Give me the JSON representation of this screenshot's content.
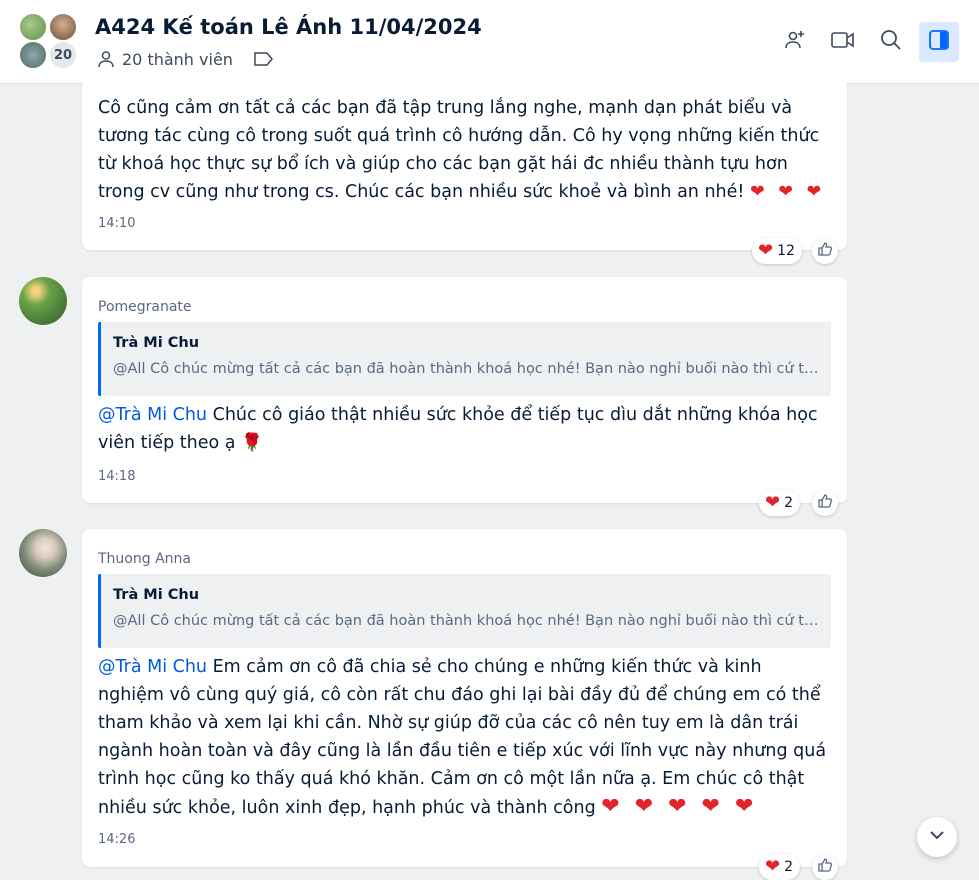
{
  "header": {
    "title": "A424 Kế toán Lê Ánh 11/04/2024",
    "member_count_badge": "20",
    "members_label": "20 thành viên",
    "icons": [
      "add-member-icon",
      "video-call-icon",
      "search-icon",
      "sidebar-toggle-icon"
    ]
  },
  "messages": [
    {
      "text": "Cô cũng cảm ơn tất cả các bạn đã tập trung lắng nghe, mạnh dạn phát biểu và tương tác cùng cô trong suốt quá trình cô hướng dẫn. Cô hy vọng những kiến thức từ khoá học thực sự bổ ích và giúp cho các bạn gặt hái đc nhiều thành tựu hơn trong cv cũng như trong cs. Chúc các bạn nhiều sức khoẻ và bình an nhé!",
      "hearts": "❤ ❤ ❤",
      "time": "14:10",
      "reaction_count": "12"
    },
    {
      "sender": "Pomegranate",
      "quote_author": "Trà Mi Chu",
      "quote_text": "@All Cô chúc mừng tất cả các bạn đã hoàn thành khoá học nhé! Bạn nào nghỉ buổi nào thì cứ tr...",
      "mention": "@Trà Mi Chu",
      "text": " Chúc cô giáo thật nhiều sức khỏe để tiếp tục dìu dắt những khóa học viên tiếp theo ạ 🌹",
      "time": "14:18",
      "reaction_count": "2"
    },
    {
      "sender": "Thuong Anna",
      "quote_author": "Trà Mi Chu",
      "quote_text": "@All Cô chúc mừng tất cả các bạn đã hoàn thành khoá học nhé! Bạn nào nghỉ buổi nào thì cứ tr...",
      "mention": "@Trà Mi Chu",
      "text": " Em cảm ơn cô đã chia sẻ cho chúng e những kiến thức và kinh nghiệm vô cùng quý giá, cô còn rất chu đáo ghi lại bài đầy đủ để chúng em có thể tham khảo và xem lại khi cần. Nhờ sự giúp đỡ của các cô nên tuy em là dân trái ngành hoàn toàn và đây cũng là lần đầu tiên e tiếp xúc với lĩnh vực này nhưng quá trình học cũng ko thấy quá khó khăn. Cảm ơn cô một lần nữa ạ. Em chúc cô thật nhiều sức khỏe, luôn xinh đẹp, hạnh phúc và thành công",
      "hearts": "❤ ❤ ❤ ❤ ❤",
      "time": "14:26",
      "reaction_count": "2"
    }
  ],
  "colors": {
    "accent": "#0068ff",
    "mention": "#005ae0",
    "heart": "#e0262b",
    "background": "#eef0f2"
  }
}
